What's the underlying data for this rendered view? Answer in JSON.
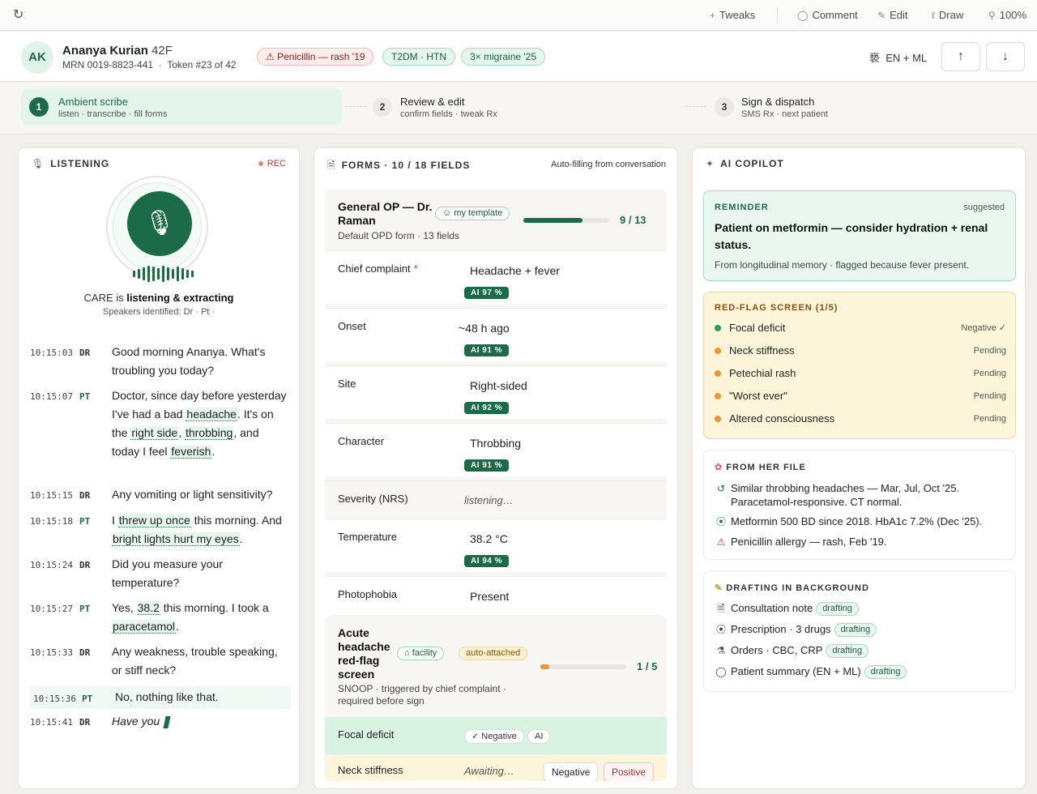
{
  "toolbar": {
    "refresh_icon": "refresh-icon",
    "tweaks": "Tweaks",
    "comment": "Comment",
    "edit": "Edit",
    "draw": "Draw",
    "zoom": "100%"
  },
  "patient": {
    "initials": "AK",
    "name": "Ananya Kurian",
    "age_sex": "42F",
    "mrn": "MRN 0019-8823-441",
    "token": "Token #23 of 42",
    "chips": [
      "Penicillin — rash '19",
      "T2DM · HTN",
      "3× migraine '25"
    ],
    "language": "EN + ML"
  },
  "steps": [
    {
      "num": "1",
      "title": "Ambient scribe",
      "sub": "listen · transcribe · fill forms"
    },
    {
      "num": "2",
      "title": "Review & edit",
      "sub": "confirm fields · tweak Rx"
    },
    {
      "num": "3",
      "title": "Sign & dispatch",
      "sub": "SMS Rx · next patient"
    }
  ],
  "listening": {
    "title": "LISTENING",
    "rec": "REC",
    "status_prefix": "CARE is ",
    "status_bold": "listening & extracting",
    "speakers": "Speakers identified: Dr · Pt ·",
    "transcript": [
      {
        "ts": "10:15:03",
        "sp": "DR"
      },
      {
        "ts": "10:15:07",
        "sp": "PT"
      },
      {
        "ts": "10:15:15",
        "sp": "DR",
        "text": "Any vomiting or light sensitivity?"
      },
      {
        "ts": "10:15:18",
        "sp": "PT"
      },
      {
        "ts": "10:15:24",
        "sp": "DR",
        "text": "Did you measure your temperature?"
      },
      {
        "ts": "10:15:27",
        "sp": "PT"
      },
      {
        "ts": "10:15:33",
        "sp": "DR",
        "text": "Any weakness, trouble speaking, or stiff neck?"
      },
      {
        "ts": "10:15:36",
        "sp": "PT",
        "text": "No, nothing like that."
      },
      {
        "ts": "10:15:41",
        "sp": "DR",
        "text": "Have you"
      }
    ],
    "t0": "Good morning Ananya. What's troubling you today?",
    "t1": {
      "a": "Doctor, since day before yesterday I've had a bad ",
      "h1": "headache",
      "b": ". It's on the ",
      "h2": "right side",
      "c": ", ",
      "h3": "throbbing",
      "d": ", and today I feel ",
      "h4": "feverish",
      "e": "."
    },
    "t3": {
      "a": "I ",
      "h1": "threw up once",
      "b": " this morning. And ",
      "h2": "bright lights hurt my eyes",
      "c": "."
    },
    "t5": {
      "a": "Yes, ",
      "h1": "38.2",
      "b": " this morning. I took a ",
      "h2": "paracetamol",
      "c": "."
    }
  },
  "forms": {
    "title": "FORMS · 10 / 18 FIELDS",
    "autofill": "Auto-filling from conversation",
    "general": {
      "title": "General OP — Dr. Raman",
      "tag": "my template",
      "sub": "Default OPD form · 13 fields",
      "done": 9,
      "total": 13,
      "count": "9  /  13"
    },
    "fields": [
      {
        "label": "Chief complaint",
        "required": "*",
        "value": "Headache + fever",
        "ai": "AI 97 %"
      },
      {
        "label": "Onset",
        "value": "~48 h ago",
        "ai": "AI 91 %"
      },
      {
        "label": "Site",
        "value": "Right-sided",
        "ai": "AI 92 %"
      },
      {
        "label": "Character",
        "value": "Throbbing",
        "ai": "AI 91 %"
      },
      {
        "label": "Severity (NRS)",
        "value": "listening…"
      },
      {
        "label": "Temperature",
        "value": "38.2 °C",
        "ai": "AI 94 %"
      },
      {
        "label": "Photophobia",
        "value": "Present"
      }
    ],
    "screen": {
      "title": "Acute headache red-flag screen",
      "tag1": "facility",
      "tag2": "auto-attached",
      "sub": "SNOOP · triggered by chief complaint · required before sign",
      "done": 1,
      "total": 5,
      "count": "1  /  5",
      "row1_label": "Focal deficit",
      "row1_chip1": "✓ Negative",
      "row1_chip2": "AI",
      "row2_label": "Neck stiffness",
      "row2_status": "Awaiting…",
      "btn_neg": "Negative",
      "btn_pos": "Positive"
    }
  },
  "copilot": {
    "title": "AI COPILOT",
    "reminder": {
      "label": "REMINDER",
      "badge": "suggested",
      "text": "Patient on metformin — consider hydration + renal status.",
      "sub": "From longitudinal memory · flagged because fever present."
    },
    "redflag": {
      "label": "RED-FLAG SCREEN (1/5)",
      "items": [
        {
          "name": "Focal deficit",
          "status": "Negative ✓",
          "color": "#21a366"
        },
        {
          "name": "Neck stiffness",
          "status": "Pending",
          "color": "#e89a2c"
        },
        {
          "name": "Petechial rash",
          "status": "Pending",
          "color": "#e89a2c"
        },
        {
          "name": "\"Worst ever\"",
          "status": "Pending",
          "color": "#e89a2c"
        },
        {
          "name": "Altered consciousness",
          "status": "Pending",
          "color": "#e89a2c"
        }
      ]
    },
    "file": {
      "label": "FROM HER FILE",
      "items": [
        {
          "icon": "history-icon",
          "text": "Similar throbbing headaches — Mar, Jul, Oct '25. Paracetamol-responsive. CT normal."
        },
        {
          "icon": "pill-icon",
          "text": "Metformin 500 BD since 2018. HbA1c 7.2% (Dec '25)."
        },
        {
          "icon": "warning-icon",
          "text": "Penicillin allergy — rash, Feb '19."
        }
      ]
    },
    "drafting": {
      "label": "DRAFTING IN BACKGROUND",
      "items": [
        {
          "icon": "document-icon",
          "text": "Consultation note",
          "tag": "drafting"
        },
        {
          "icon": "pill-icon",
          "text": "Prescription · 3 drugs",
          "tag": "drafting"
        },
        {
          "icon": "flask-icon",
          "text": "Orders · CBC, CRP",
          "tag": "drafting"
        },
        {
          "icon": "chat-icon",
          "text": "Patient summary (EN + ML)",
          "tag": "drafting"
        }
      ]
    }
  }
}
